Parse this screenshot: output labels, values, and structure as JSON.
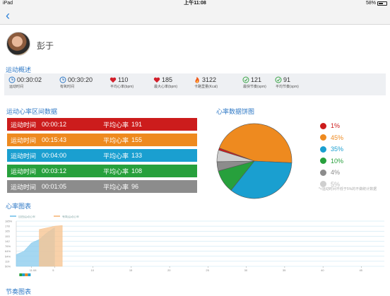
{
  "status_bar": {
    "device": "iPad",
    "time": "上午11:08",
    "battery": "58%"
  },
  "nav": {
    "back_icon": "chevron-left-icon"
  },
  "user": {
    "name": "彭于"
  },
  "overview": {
    "title": "运动概述",
    "items": [
      {
        "icon": "clock-icon",
        "value": "00:30:02",
        "label": "运动时间"
      },
      {
        "icon": "clock-icon",
        "value": "00:30:20",
        "label": "有氧时间"
      },
      {
        "icon": "heart-icon",
        "value": "110",
        "label": "平均心率(bpm)"
      },
      {
        "icon": "heart-icon",
        "value": "185",
        "label": "最大心率(bpm)"
      },
      {
        "icon": "flame-icon",
        "value": "3122",
        "label": "卡路里量(Kcal)"
      },
      {
        "icon": "gauge-icon",
        "value": "121",
        "label": "最快节奏(spm)"
      },
      {
        "icon": "gauge-icon",
        "value": "91",
        "label": "平均节奏(spm)"
      }
    ]
  },
  "zones": {
    "title": "运动心率区间数据",
    "time_label": "运动时间",
    "avg_label": "平均心率",
    "rows": [
      {
        "time": "00:00:12",
        "avg": "191",
        "color": "#cc1c1c"
      },
      {
        "time": "00:15:43",
        "avg": "155",
        "color": "#ee8a1f"
      },
      {
        "time": "00:04:00",
        "avg": "133",
        "color": "#1a9fd0"
      },
      {
        "time": "00:03:12",
        "avg": "108",
        "color": "#27a03c"
      },
      {
        "time": "00:01:05",
        "avg": "96",
        "color": "#8c8c8c"
      }
    ]
  },
  "pie": {
    "title": "心率数据饼图",
    "note": "*<运动时间不低于5%的不做统计数据",
    "slices": [
      {
        "label": "1%",
        "value": 1,
        "color": "#cc1c1c"
      },
      {
        "label": "45%",
        "value": 45,
        "color": "#ee8a1f"
      },
      {
        "label": "35%",
        "value": 35,
        "color": "#1a9fd0"
      },
      {
        "label": "10%",
        "value": 10,
        "color": "#27a03c"
      },
      {
        "label": "4%",
        "value": 4,
        "color": "#8c8c8c"
      },
      {
        "label": "5%",
        "value": 5,
        "color": "#cfcfcf"
      }
    ]
  },
  "chart_data": {
    "type": "area",
    "title": "心率图表",
    "legend": [
      "自由运动心率",
      "有氧运动心率"
    ],
    "y_ticks": [
      "185%",
      "178",
      "165",
      "153",
      "142",
      "76%",
      "64%",
      "54%",
      "119",
      "50%"
    ],
    "x_ticks": [
      "11:08",
      "5",
      "10",
      "15",
      "20",
      "25",
      "30",
      "35",
      "40",
      "45"
    ],
    "xlim": [
      0,
      48
    ],
    "ylim": [
      50,
      185
    ],
    "series": [
      {
        "name": "自由运动心率",
        "color": "#8fcdee",
        "x": [
          0,
          1,
          2,
          3,
          4,
          5
        ],
        "y": [
          85,
          95,
          120,
          130,
          150,
          165
        ]
      },
      {
        "name": "有氧运动心率",
        "color": "#f7c594",
        "x": [
          3,
          4,
          5,
          6
        ],
        "y": [
          160,
          165,
          170,
          172
        ]
      }
    ],
    "zone_strip": [
      "#27a03c",
      "#1a9fd0",
      "#ee8a1f",
      "#1a9fd0"
    ]
  },
  "next_section": {
    "title": "节奏图表"
  }
}
